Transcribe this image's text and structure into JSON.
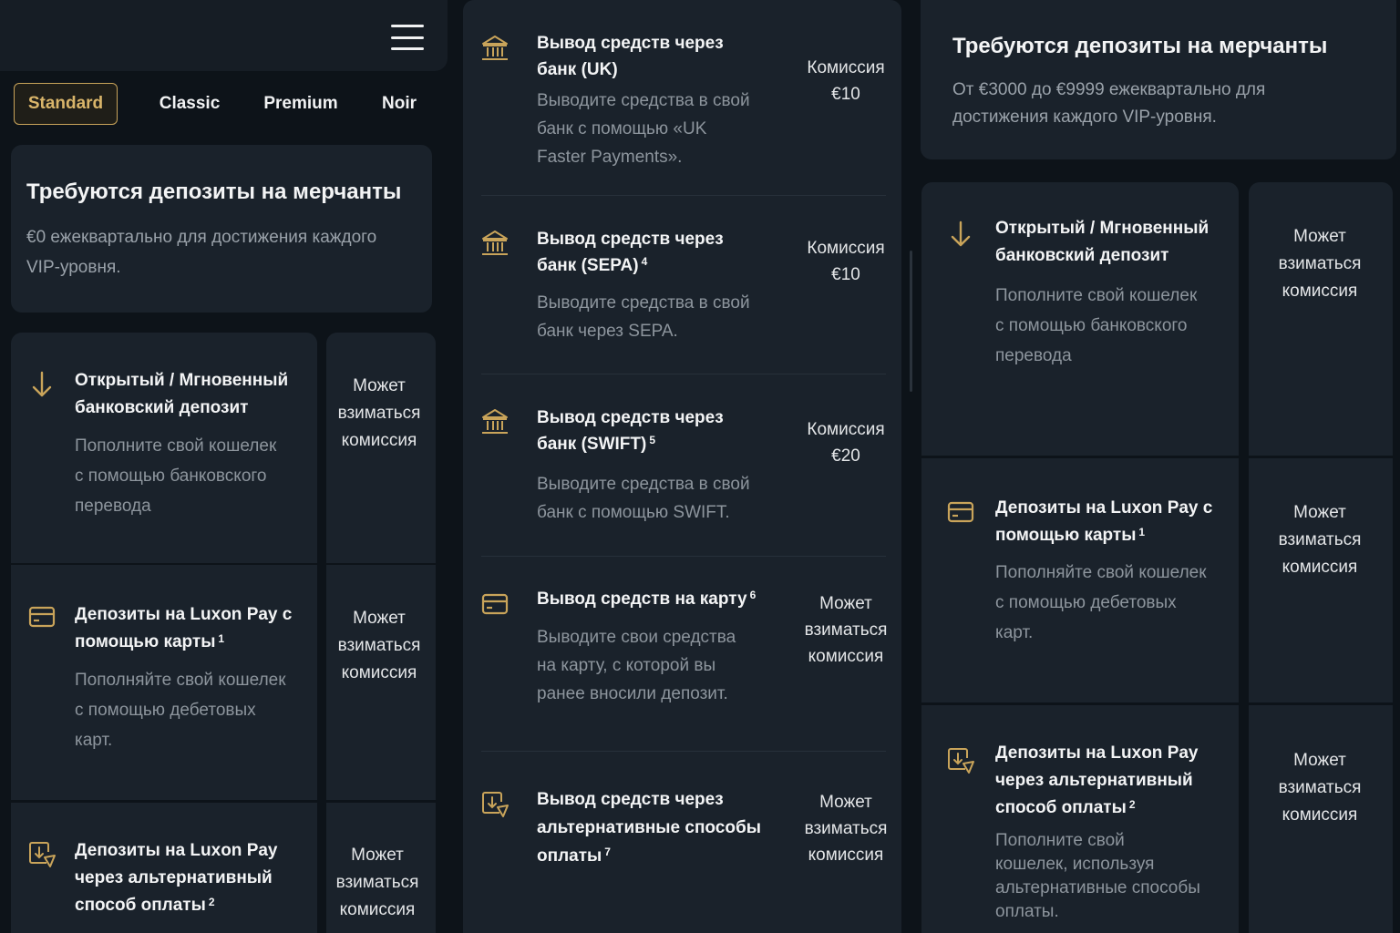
{
  "menu": {
    "icon": "hamburger-menu-icon"
  },
  "tiers": [
    {
      "label": "Standard",
      "active": true
    },
    {
      "label": "Classic",
      "active": false
    },
    {
      "label": "Premium",
      "active": false
    },
    {
      "label": "Noir",
      "active": false
    }
  ],
  "left": {
    "requirement": {
      "title": "Требуются депозиты на мерчанты",
      "desc_line1": "€0 ежеквартально для достижения каждого",
      "desc_line2": "VIP-уровня."
    },
    "rows": [
      {
        "icon": "arrow-down-icon",
        "title_l1": "Открытый / Мгновенный",
        "title_l2": "банковский депозит",
        "sup": "",
        "desc_l1": "Пополните свой кошелек",
        "desc_l2": "с помощью банковского",
        "desc_l3": "перевода",
        "fee_l1": "Может",
        "fee_l2": "взиматься",
        "fee_l3": "комиссия"
      },
      {
        "icon": "card-icon",
        "title_l1": "Депозиты на Luxon Pay с",
        "title_l2": "помощью карты",
        "sup": "1",
        "desc_l1": "Пополняйте свой кошелек",
        "desc_l2": "с помощью дебетовых",
        "desc_l3": "карт.",
        "fee_l1": "Может",
        "fee_l2": "взиматься",
        "fee_l3": "комиссия"
      },
      {
        "icon": "alt-payment-icon",
        "title_l1": "Депозиты на Luxon Pay",
        "title_l2": "через альтернативный",
        "title_l3": "способ оплаты",
        "sup": "2",
        "fee_l1": "Может",
        "fee_l2": "взиматься",
        "fee_l3": "комиссия"
      }
    ]
  },
  "middle": {
    "rows": [
      {
        "icon": "bank-icon",
        "title_l1": "Вывод средств через",
        "title_l2": "банк (UK)",
        "sup": "",
        "desc_l1": "Выводите средства в свой",
        "desc_l2": "банк с помощью «UK",
        "desc_l3": "Faster Payments».",
        "fee_l1": "Комиссия",
        "fee_l2": "€10"
      },
      {
        "icon": "bank-icon",
        "title_l1": "Вывод средств через",
        "title_l2": "банк (SEPA)",
        "sup": "4",
        "desc_l1": "Выводите средства в свой",
        "desc_l2": "банк через SEPA.",
        "fee_l1": "Комиссия",
        "fee_l2": "€10"
      },
      {
        "icon": "bank-icon",
        "title_l1": "Вывод средств через",
        "title_l2": "банк (SWIFT)",
        "sup": "5",
        "desc_l1": "Выводите средства в свой",
        "desc_l2": "банк с помощью SWIFT.",
        "fee_l1": "Комиссия",
        "fee_l2": "€20"
      },
      {
        "icon": "card-icon",
        "title_l1": "Вывод средств на карту",
        "sup": "6",
        "desc_l1": "Выводите свои средства",
        "desc_l2": "на карту, с которой вы",
        "desc_l3": "ранее вносили депозит.",
        "fee_l1": "Может",
        "fee_l2": "взиматься",
        "fee_l3": "комиссия"
      },
      {
        "icon": "alt-payment-icon",
        "title_l1": "Вывод средств через",
        "title_l2": "альтернативные способы",
        "title_l3": "оплаты",
        "sup": "7",
        "fee_l1": "Может",
        "fee_l2": "взиматься",
        "fee_l3": "комиссия"
      }
    ]
  },
  "right": {
    "requirement": {
      "title": "Требуются депозиты на мерчанты",
      "desc_line1": "От €3000 до €9999 ежеквартально для",
      "desc_line2": "достижения каждого VIP-уровня."
    },
    "rows": [
      {
        "icon": "arrow-down-icon",
        "title_l1": "Открытый / Мгновенный",
        "title_l2": "банковский депозит",
        "desc_l1": "Пополните свой кошелек",
        "desc_l2": "с помощью банковского",
        "desc_l3": "перевода",
        "fee_l1": "Может",
        "fee_l2": "взиматься",
        "fee_l3": "комиссия"
      },
      {
        "icon": "card-icon",
        "title_l1": "Депозиты на Luxon Pay с",
        "title_l2": "помощью карты",
        "sup": "1",
        "desc_l1": "Пополняйте свой кошелек",
        "desc_l2": "с помощью дебетовых",
        "desc_l3": "карт.",
        "fee_l1": "Может",
        "fee_l2": "взиматься",
        "fee_l3": "комиссия"
      },
      {
        "icon": "alt-payment-icon",
        "title_l1": "Депозиты на Luxon Pay",
        "title_l2": "через альтернативный",
        "title_l3": "способ оплаты",
        "sup": "2",
        "desc_l1": "Пополните свой",
        "desc_l2": "кошелек, используя",
        "desc_l3": "альтернативные способы",
        "desc_l4": "оплаты.",
        "fee_l1": "Может",
        "fee_l2": "взиматься",
        "fee_l3": "комиссия"
      }
    ]
  },
  "colors": {
    "accent": "#c9a45a",
    "background": "#0d1319",
    "card": "#1a222b"
  }
}
